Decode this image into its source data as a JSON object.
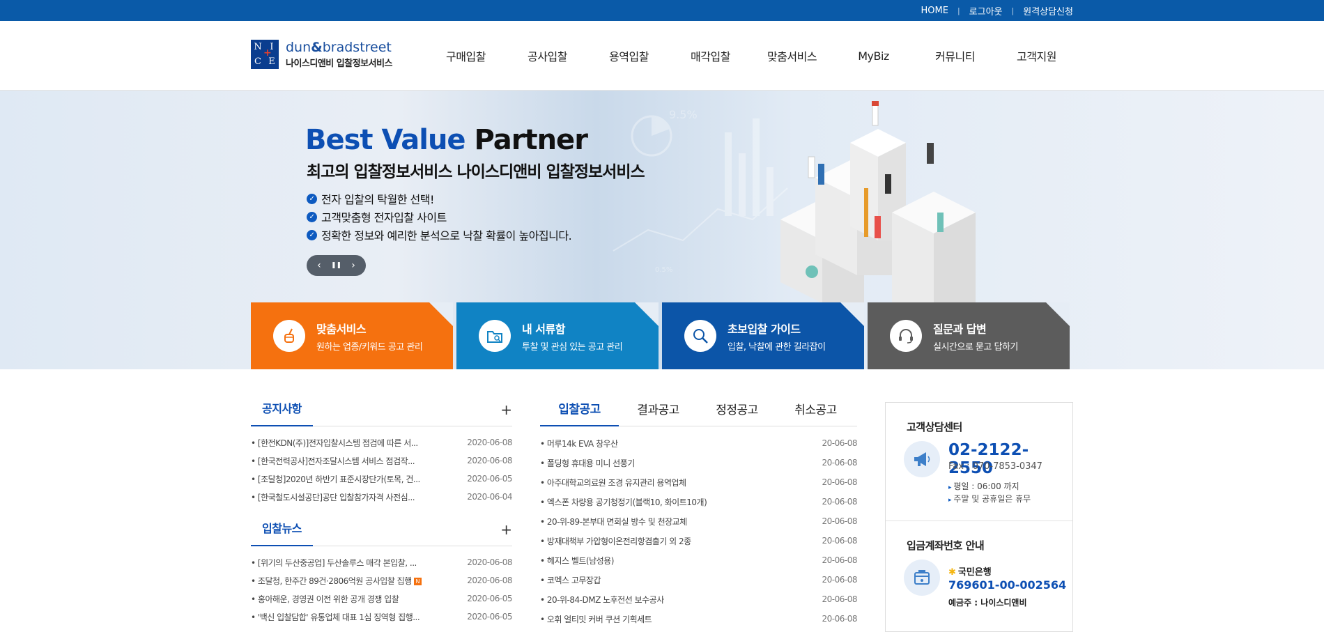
{
  "topnav": {
    "home": "HOME",
    "logout": "로그아웃",
    "remote": "원격상담신청"
  },
  "logo": {
    "letters": [
      "N",
      "I",
      "C",
      "E"
    ],
    "brand_a": "dun",
    "brand_amp": "&",
    "brand_b": "bradstreet",
    "subtitle": "나이스디앤비 입찰정보서비스"
  },
  "gnb": [
    "구매입찰",
    "공사입찰",
    "용역입찰",
    "매각입찰",
    "맞춤서비스",
    "MyBiz",
    "커뮤니티",
    "고객지원"
  ],
  "hero": {
    "title_blue": "Best Value",
    "title_dark": "Partner",
    "subtitle": "최고의 입찰정보서비스 나이스디앤비 입찰정보서비스",
    "bullets": [
      "전자 입찰의 탁월한 선택!",
      "고객맞춤형 전자입찰 사이트",
      "정확한 정보와 예리한 분석으로 낙찰 확률이 높아집니다."
    ],
    "controls": {
      "prev": "‹",
      "pause": "❚❚",
      "next": "›"
    },
    "deco_number": "9.5%",
    "deco_number2": "0.5%"
  },
  "quick": [
    {
      "title": "맞춤서비스",
      "desc": "원하는 업종/키워드 공고 관리",
      "icon": "cup-icon",
      "color": "#f5710f"
    },
    {
      "title": "내 서류함",
      "desc": "투찰 및 관심 있는 공고 관리",
      "icon": "folder-icon",
      "color": "#1083c4"
    },
    {
      "title": "초보입찰 가이드",
      "desc": "입찰, 낙찰에 관한 길라잡이",
      "icon": "search-icon",
      "color": "#0c55a8"
    },
    {
      "title": "질문과 답변",
      "desc": "실시간으로 묻고 답하기",
      "icon": "headset-icon",
      "color": "#5c5c5c"
    }
  ],
  "notice": {
    "title": "공지사항",
    "plus": "+",
    "items": [
      {
        "text": "[한전KDN(주)]전자입찰시스템 점검에 따른 서...",
        "date": "2020-06-08"
      },
      {
        "text": "[한국전력공사]전자조달시스템 서비스 점검작...",
        "date": "2020-06-08"
      },
      {
        "text": "[조달청]2020년 하반기 표준시장단가(토목, 건...",
        "date": "2020-06-05"
      },
      {
        "text": "[한국철도시설공단]공단 입찰참가자격 사전심...",
        "date": "2020-06-04"
      }
    ]
  },
  "news": {
    "title": "입찰뉴스",
    "plus": "+",
    "new_badge": "N",
    "items": [
      {
        "text": "[위기의 두산중공업] 두산솔루스 매각 본입찰, ...",
        "date": "2020-06-08"
      },
      {
        "text": "조달청, 한주간 89건·2806억원 공사입찰 집행",
        "date": "2020-06-08"
      },
      {
        "text": "홍아해운, 경영권 이전 위한 공개 경쟁 입찰",
        "date": "2020-06-05"
      },
      {
        "text": "'백신 입찰담합' 유통업체 대표 1심 징역형 집행...",
        "date": "2020-06-05"
      }
    ]
  },
  "bids": {
    "tabs": [
      "입찰공고",
      "결과공고",
      "정정공고",
      "취소공고"
    ],
    "items": [
      {
        "text": "머루14k EVA 창우산",
        "date": "20-06-08"
      },
      {
        "text": "폴딩형 휴대용 미니 선풍기",
        "date": "20-06-08"
      },
      {
        "text": "아주대학교의료원 조경 유지관리 용역업체",
        "date": "20-06-08"
      },
      {
        "text": "엑스폰 차량용 공기청정기(블랙10, 화이트10개)",
        "date": "20-06-08"
      },
      {
        "text": "20-위-89-본부대 면회실 방수 및 천장교체",
        "date": "20-06-08"
      },
      {
        "text": "방재대책부 가압형이온전리항겸출기 외 2종",
        "date": "20-06-08"
      },
      {
        "text": "헤지스 벨트(남성용)",
        "date": "20-06-08"
      },
      {
        "text": "코멕스 고무장갑",
        "date": "20-06-08"
      },
      {
        "text": "20-위-84-DMZ 노후전선 보수공사",
        "date": "20-06-08"
      },
      {
        "text": "오휘 얼티밋 커버 쿠션 기획세트",
        "date": "20-06-08"
      }
    ]
  },
  "side": {
    "cs_title": "고객상담센터",
    "tel": "02-2122-2550",
    "fax": "Fax : 070-7853-0347",
    "hours": [
      "평일 : 06:00 까지",
      "주말 및 공휴일은 휴무"
    ],
    "acct_title": "입금계좌번호 안내",
    "bank": "국민은행",
    "account": "769601-00-002564",
    "holder": "예금주 : 나이스디앤비"
  }
}
